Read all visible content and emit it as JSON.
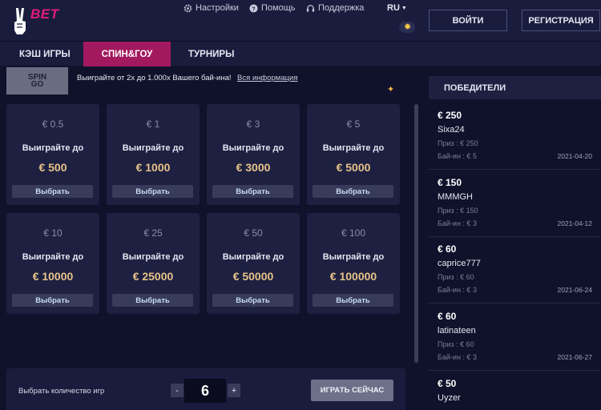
{
  "brand": {
    "name": "BET",
    "accent": "#e21b7f"
  },
  "topnav": {
    "settings": "Настройки",
    "help": "Помощь",
    "support": "Поддержка",
    "lang": "RU"
  },
  "auth": {
    "login": "ВОЙТИ",
    "register": "РЕГИСТРАЦИЯ"
  },
  "tabs": [
    {
      "label": "КЭШ ИГРЫ"
    },
    {
      "label": "СПИН&ГОУ"
    },
    {
      "label": "ТУРНИРЫ"
    }
  ],
  "banner": {
    "logo_line1": "SPIN",
    "logo_line2": "GO",
    "text": "Выиграйте от 2x до 1.000x Вашего бай-ина!",
    "link": "Вся информация"
  },
  "cards": [
    {
      "buyin": "€ 0.5",
      "title": "Выиграйте до",
      "prize": "€ 500",
      "button": "Выбрать"
    },
    {
      "buyin": "€ 1",
      "title": "Выиграйте до",
      "prize": "€ 1000",
      "button": "Выбрать"
    },
    {
      "buyin": "€ 3",
      "title": "Выиграйте до",
      "prize": "€ 3000",
      "button": "Выбрать"
    },
    {
      "buyin": "€ 5",
      "title": "Выиграйте до",
      "prize": "€ 5000",
      "button": "Выбрать"
    },
    {
      "buyin": "€ 10",
      "title": "Выиграйте до",
      "prize": "€ 10000",
      "button": "Выбрать"
    },
    {
      "buyin": "€ 25",
      "title": "Выиграйте до",
      "prize": "€ 25000",
      "button": "Выбрать"
    },
    {
      "buyin": "€ 50",
      "title": "Выиграйте до",
      "prize": "€ 50000",
      "button": "Выбрать"
    },
    {
      "buyin": "€ 100",
      "title": "Выиграйте до",
      "prize": "€ 100000",
      "button": "Выбрать"
    }
  ],
  "playbar": {
    "label": "Выбрать количество игр",
    "minus": "-",
    "value": "6",
    "plus": "+",
    "play": "ИГРАТЬ СЕЙЧАС"
  },
  "winners": {
    "title": "ПОБЕДИТЕЛИ",
    "items": [
      {
        "amount": "€ 250",
        "name": "Sixa24",
        "prize": "Приз : € 250",
        "buyin": "Бай-ин : € 5",
        "date": "2021-04-20"
      },
      {
        "amount": "€ 150",
        "name": "MMMGH",
        "prize": "Приз : € 150",
        "buyin": "Бай-ин : € 3",
        "date": "2021-04-12"
      },
      {
        "amount": "€ 60",
        "name": "caprice777",
        "prize": "Приз : € 60",
        "buyin": "Бай-ин : € 3",
        "date": "2021-06-24"
      },
      {
        "amount": "€ 60",
        "name": "latinateen",
        "prize": "Приз : € 60",
        "buyin": "Бай-ин : € 3",
        "date": "2021-06-27"
      },
      {
        "amount": "€ 50",
        "name": "Uyzer"
      }
    ]
  }
}
